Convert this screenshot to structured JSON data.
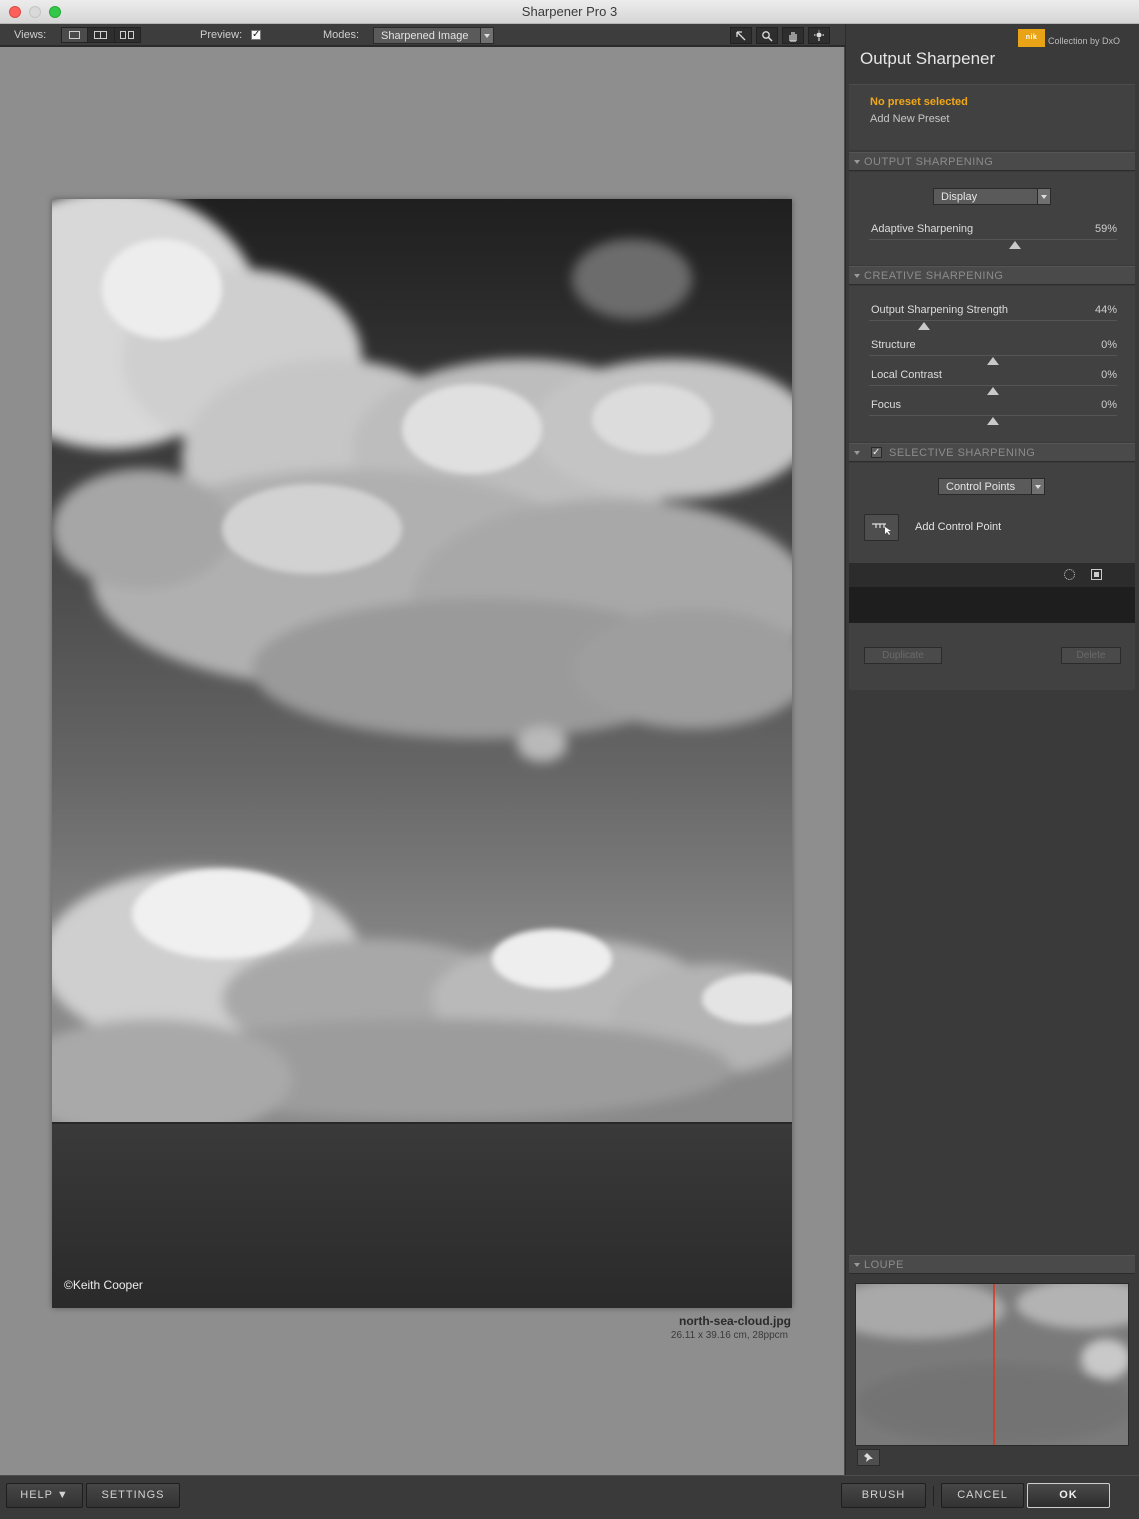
{
  "window": {
    "title": "Sharpener Pro 3"
  },
  "toolbar": {
    "views_label": "Views:",
    "preview_label": "Preview:",
    "preview_checked": "✓",
    "modes_label": "Modes:",
    "modes_value": "Sharpened Image",
    "tools": [
      "cursor-icon",
      "zoom-icon",
      "hand-icon",
      "light-icon"
    ]
  },
  "canvas": {
    "copyright": "©Keith Cooper",
    "file_name": "north-sea-cloud.jpg",
    "file_dims": "26.11 x 39.16 cm, 28ppcm"
  },
  "panel": {
    "logo_mark": "nik",
    "logo_text": "Collection by DxO",
    "title": "Output Sharpener",
    "preset": {
      "title": "No preset selected",
      "add": "Add New Preset"
    },
    "output_sharpening": {
      "header": "OUTPUT SHARPENING",
      "display_select": "Display",
      "adaptive": {
        "label": "Adaptive Sharpening",
        "value": "59%",
        "level": 59
      }
    },
    "creative_sharpening": {
      "header": "CREATIVE SHARPENING",
      "sliders": [
        {
          "label": "Output Sharpening Strength",
          "value": "44%",
          "level": 22
        },
        {
          "label": "Structure",
          "value": "0%",
          "level": 50
        },
        {
          "label": "Local Contrast",
          "value": "0%",
          "level": 50
        },
        {
          "label": "Focus",
          "value": "0%",
          "level": 50
        }
      ]
    },
    "selective_sharpening": {
      "header": "SELECTIVE SHARPENING",
      "checked": "✓",
      "select": "Control Points",
      "add_cp": "Add Control Point",
      "duplicate": "Duplicate",
      "delete": "Delete"
    },
    "loupe": {
      "header": "LOUPE"
    }
  },
  "bottom": {
    "help": "HELP ▼",
    "settings": "SETTINGS",
    "brush": "BRUSH",
    "cancel": "CANCEL",
    "ok": "OK"
  },
  "colors": {
    "accent": "#f2a716",
    "loupe_line": "#e0301e"
  }
}
